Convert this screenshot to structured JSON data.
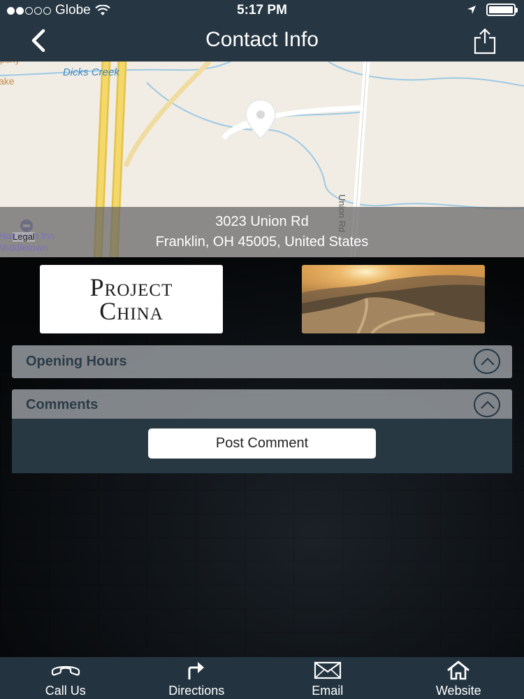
{
  "status_bar": {
    "carrier": "Globe",
    "time": "5:17 PM"
  },
  "navbar": {
    "title": "Contact Info",
    "back_icon": "chevron-left-icon",
    "share_icon": "share-icon"
  },
  "map": {
    "labels": {
      "creek": "Dicks Creek",
      "road": "Union Rd",
      "poi": "Hampton Inn",
      "poi_city": "Middletown",
      "legal": "Legal",
      "partial_top": "pony",
      "partial_left": "ake"
    },
    "address_line1": "3023 Union Rd",
    "address_line2": "Franklin, OH 45005, United States",
    "pin_icon": "map-pin-icon"
  },
  "logo": {
    "line1": "Project",
    "line2": "China"
  },
  "sections": {
    "opening_hours": "Opening Hours",
    "comments": "Comments",
    "post_comment": "Post Comment"
  },
  "tabbar": {
    "items": [
      {
        "label": "Call Us",
        "icon": "phone-icon"
      },
      {
        "label": "Directions",
        "icon": "directions-arrow-icon"
      },
      {
        "label": "Email",
        "icon": "envelope-icon"
      },
      {
        "label": "Website",
        "icon": "home-icon"
      }
    ]
  },
  "colors": {
    "nav_bg": "#263642",
    "panel_bg": "#969ba0",
    "section_text": "#2c3b47",
    "tabbar_bg": "#233440"
  }
}
